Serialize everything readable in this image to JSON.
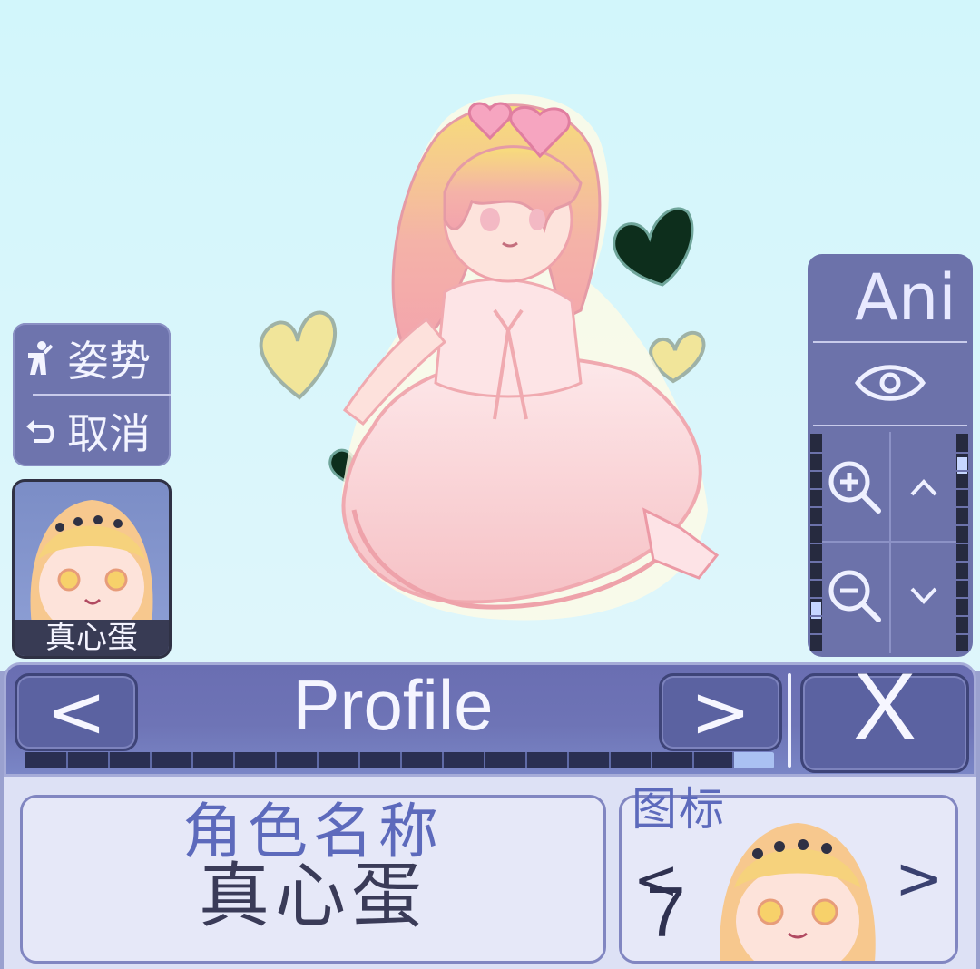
{
  "left_panel": {
    "pose_label": "姿势",
    "cancel_label": "取消"
  },
  "character_thumb": {
    "name": "真心蛋"
  },
  "right_panel": {
    "ani_label": "Ani"
  },
  "header": {
    "prev_label": "<",
    "title": "Profile",
    "next_label": ">",
    "close_label": "X",
    "progress_fraction": 0.055
  },
  "profile": {
    "name_field_label": "角色名称",
    "name_value": "真心蛋",
    "icon_field_label": "图标",
    "icon_number": "7",
    "icon_prev_label": "<",
    "icon_next_label": ">"
  },
  "colors": {
    "panel": "#6c72aa",
    "header": "#6a6eb2",
    "content_bg": "#dde1f5",
    "accent_text": "#5d6abc"
  }
}
